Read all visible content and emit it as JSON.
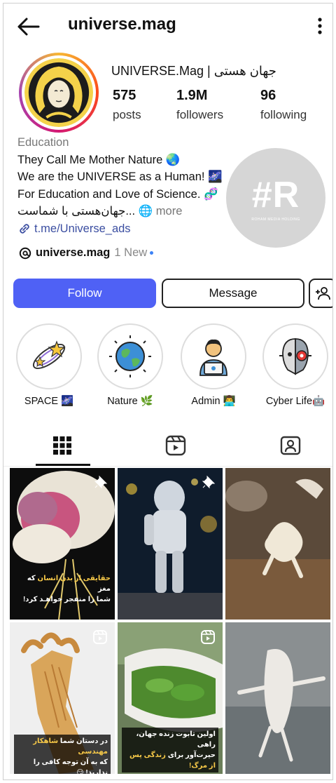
{
  "header": {
    "handle": "universe.mag"
  },
  "profile": {
    "display_name": "UNIVERSE.Mag | جهان هستی",
    "stats": [
      {
        "value": "575",
        "label": "posts"
      },
      {
        "value": "1.9M",
        "label": "followers"
      },
      {
        "value": "96",
        "label": "following"
      }
    ],
    "category": "Education",
    "bio_lines": [
      "They Call Me Mother Nature 🌏",
      "We are the UNIVERSE as a Human! 🌌",
      "For Education and Love of Science. 🧬"
    ],
    "bio_persian": "جهان‌هستی با شماست... 🌐",
    "more_label": "more",
    "link": "t.me/Universe_ads",
    "threads_handle": "universe.mag",
    "threads_new": "1 New"
  },
  "watermark": {
    "big": "#R",
    "small": "ROHAM MEDIA HOLDING"
  },
  "buttons": {
    "follow": "Follow",
    "message": "Message"
  },
  "highlights": [
    {
      "label": "SPACE 🌌",
      "icon": "orbit-stars-icon"
    },
    {
      "label": "Nature 🌿",
      "icon": "globe-icon"
    },
    {
      "label": "Admin 👨‍💻",
      "icon": "admin-icon"
    },
    {
      "label": "Cyber Life🤖",
      "icon": "robot-icon"
    }
  ],
  "tabs": [
    "grid-icon",
    "reels-icon",
    "tagged-icon"
  ],
  "posts": [
    {
      "caption_a": "حقایقی از بدن انسان",
      "caption_b": "که مغز",
      "caption_c": "شما را منفجر خواهـد کرد!",
      "pinned": true
    },
    {
      "pinned": true
    },
    {},
    {
      "caption_a": "شاهکار مهندسی",
      "caption_b": "در دستان شما",
      "caption_c": "که به آن توجه کافی را ندارید! 😏",
      "reel": true
    },
    {
      "caption_a": "اولین تابوت زنده جهان، راهی",
      "caption_b": "حیرت‌آور برای",
      "caption_c": "زندگی پس از مرگ!",
      "reel": true
    },
    {}
  ]
}
